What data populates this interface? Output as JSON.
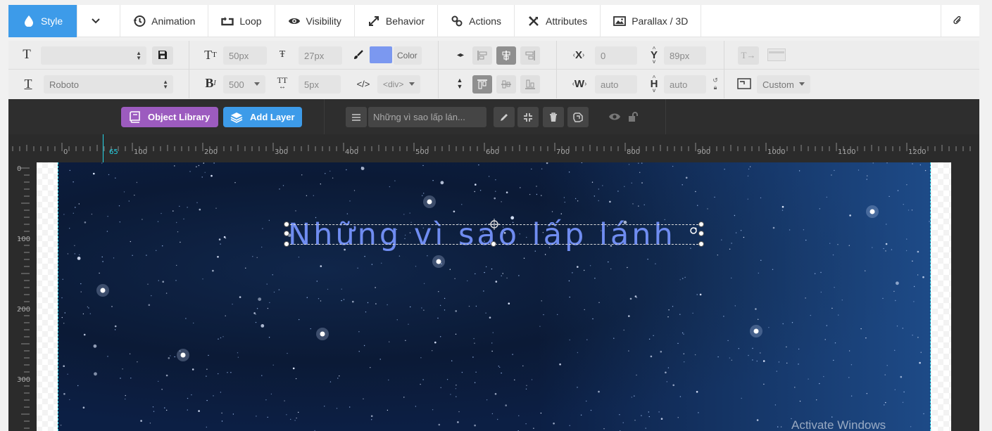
{
  "tabs": {
    "style": "Style",
    "animation": "Animation",
    "loop": "Loop",
    "visibility": "Visibility",
    "behavior": "Behavior",
    "actions": "Actions",
    "attributes": "Attributes",
    "parallax": "Parallax / 3D"
  },
  "toolbar": {
    "row1": {
      "font_size": "50px",
      "line_height": "27px",
      "color_label": "Color",
      "color_value": "#7b98f0",
      "x_label": "X",
      "x_value": "0",
      "y_label": "Y",
      "y_value": "89px"
    },
    "row2": {
      "font_family": "Roboto",
      "font_weight": "500",
      "letter_spacing": "5px",
      "tag": "<div>",
      "w_label": "W",
      "w_value": "auto",
      "h_label": "H",
      "h_value": "auto",
      "size_mode": "Custom"
    }
  },
  "layerbar": {
    "object_library": "Object Library",
    "add_layer": "Add Layer",
    "layer_name": "Những vì sao lấp lán..."
  },
  "ruler": {
    "h_labels": [
      "0",
      "65",
      "100",
      "200",
      "300",
      "400",
      "500",
      "600",
      "700",
      "800",
      "900",
      "1000",
      "1100",
      "1200"
    ],
    "v_labels": [
      "0",
      "100",
      "200",
      "300"
    ]
  },
  "canvas": {
    "layer_text": "Những vì sao lấp lánh"
  },
  "watermark": "Activate Windows"
}
